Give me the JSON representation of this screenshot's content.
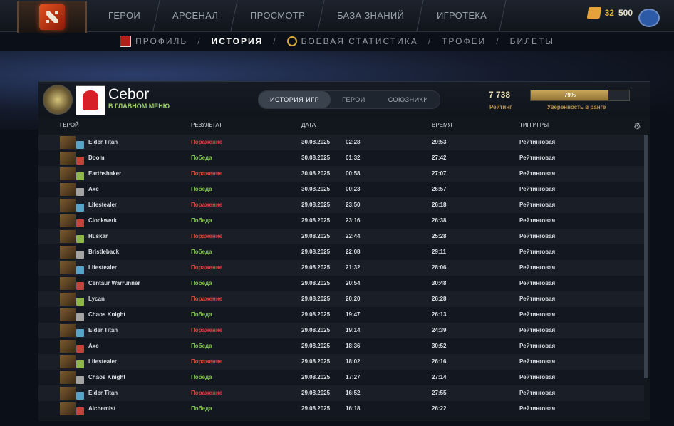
{
  "topbar": {
    "nav": [
      "ГЕРОИ",
      "АРСЕНАЛ",
      "ПРОСМОТР",
      "БАЗА ЗНАНИЙ",
      "ИГРОТЕКА"
    ],
    "shards": "32",
    "gold": "500"
  },
  "subnav": {
    "items": [
      "ПРОФИЛЬ",
      "ИСТОРИЯ",
      "БОЕВАЯ СТАТИСТИКА",
      "ТРОФЕИ",
      "БИЛЕТЫ"
    ],
    "active": "ИСТОРИЯ",
    "separator": "/"
  },
  "profile": {
    "name": "Cebor",
    "status": "В ГЛАВНОМ МЕНЮ",
    "tabs": [
      "ИСТОРИЯ ИГР",
      "ГЕРОИ",
      "СОЮЗНИКИ"
    ],
    "rating_value": "7 738",
    "rating_label": "Рейтинг",
    "confidence_text": "79%",
    "confidence_fraction": 0.79,
    "confidence_label": "Уверенность в ранге"
  },
  "table": {
    "headers": {
      "hero": "ГЕРОЙ",
      "result": "РЕЗУЛЬТАТ",
      "date": "ДАТА",
      "duration": "ВРЕМЯ",
      "type": "ТИП ИГРЫ"
    },
    "rows": [
      {
        "hero": "Elder Titan",
        "result": "Поражение",
        "win": false,
        "date": "30.08.2025",
        "time": "02:28",
        "duration": "29:53",
        "type": "Рейтинговая"
      },
      {
        "hero": "Doom",
        "result": "Победа",
        "win": true,
        "date": "30.08.2025",
        "time": "01:32",
        "duration": "27:42",
        "type": "Рейтинговая"
      },
      {
        "hero": "Earthshaker",
        "result": "Поражение",
        "win": false,
        "date": "30.08.2025",
        "time": "00:58",
        "duration": "27:07",
        "type": "Рейтинговая"
      },
      {
        "hero": "Axe",
        "result": "Победа",
        "win": true,
        "date": "30.08.2025",
        "time": "00:23",
        "duration": "26:57",
        "type": "Рейтинговая"
      },
      {
        "hero": "Lifestealer",
        "result": "Поражение",
        "win": false,
        "date": "29.08.2025",
        "time": "23:50",
        "duration": "26:18",
        "type": "Рейтинговая"
      },
      {
        "hero": "Clockwerk",
        "result": "Победа",
        "win": true,
        "date": "29.08.2025",
        "time": "23:16",
        "duration": "26:38",
        "type": "Рейтинговая"
      },
      {
        "hero": "Huskar",
        "result": "Поражение",
        "win": false,
        "date": "29.08.2025",
        "time": "22:44",
        "duration": "25:28",
        "type": "Рейтинговая"
      },
      {
        "hero": "Bristleback",
        "result": "Победа",
        "win": true,
        "date": "29.08.2025",
        "time": "22:08",
        "duration": "29:11",
        "type": "Рейтинговая"
      },
      {
        "hero": "Lifestealer",
        "result": "Поражение",
        "win": false,
        "date": "29.08.2025",
        "time": "21:32",
        "duration": "28:06",
        "type": "Рейтинговая"
      },
      {
        "hero": "Centaur Warrunner",
        "result": "Победа",
        "win": true,
        "date": "29.08.2025",
        "time": "20:54",
        "duration": "30:48",
        "type": "Рейтинговая"
      },
      {
        "hero": "Lycan",
        "result": "Поражение",
        "win": false,
        "date": "29.08.2025",
        "time": "20:20",
        "duration": "26:28",
        "type": "Рейтинговая"
      },
      {
        "hero": "Chaos Knight",
        "result": "Победа",
        "win": true,
        "date": "29.08.2025",
        "time": "19:47",
        "duration": "26:13",
        "type": "Рейтинговая"
      },
      {
        "hero": "Elder Titan",
        "result": "Поражение",
        "win": false,
        "date": "29.08.2025",
        "time": "19:14",
        "duration": "24:39",
        "type": "Рейтинговая"
      },
      {
        "hero": "Axe",
        "result": "Победа",
        "win": true,
        "date": "29.08.2025",
        "time": "18:36",
        "duration": "30:52",
        "type": "Рейтинговая"
      },
      {
        "hero": "Lifestealer",
        "result": "Поражение",
        "win": false,
        "date": "29.08.2025",
        "time": "18:02",
        "duration": "26:16",
        "type": "Рейтинговая"
      },
      {
        "hero": "Chaos Knight",
        "result": "Победа",
        "win": true,
        "date": "29.08.2025",
        "time": "17:27",
        "duration": "27:14",
        "type": "Рейтинговая"
      },
      {
        "hero": "Elder Titan",
        "result": "Поражение",
        "win": false,
        "date": "29.08.2025",
        "time": "16:52",
        "duration": "27:55",
        "type": "Рейтинговая"
      },
      {
        "hero": "Alchemist",
        "result": "Победа",
        "win": true,
        "date": "29.08.2025",
        "time": "16:18",
        "duration": "26:22",
        "type": "Рейтинговая"
      }
    ]
  },
  "colors": {
    "win": "#7bbf4f",
    "loss": "#d9463f",
    "accent": "#c9a75a"
  }
}
